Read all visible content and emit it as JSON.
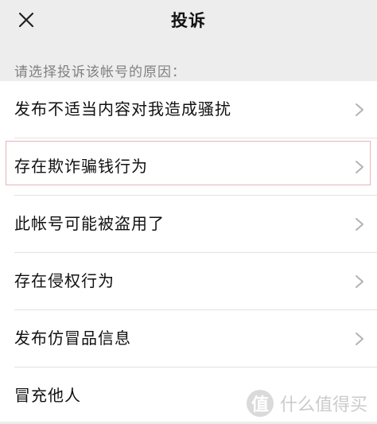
{
  "header": {
    "title": "投诉",
    "close_icon": "close-icon"
  },
  "prompt": "请选择投诉该帐号的原因：",
  "reasons": [
    {
      "label": "发布不适当内容对我造成骚扰"
    },
    {
      "label": "存在欺诈骗钱行为"
    },
    {
      "label": "此帐号可能被盗用了"
    },
    {
      "label": "存在侵权行为"
    },
    {
      "label": "发布仿冒品信息"
    },
    {
      "label": "冒充他人"
    }
  ],
  "watermark": {
    "badge": "值",
    "text": "什么值得买"
  },
  "colors": {
    "background": "#ededed",
    "list_background": "#ffffff",
    "highlight_border": "#e7b4ba"
  }
}
